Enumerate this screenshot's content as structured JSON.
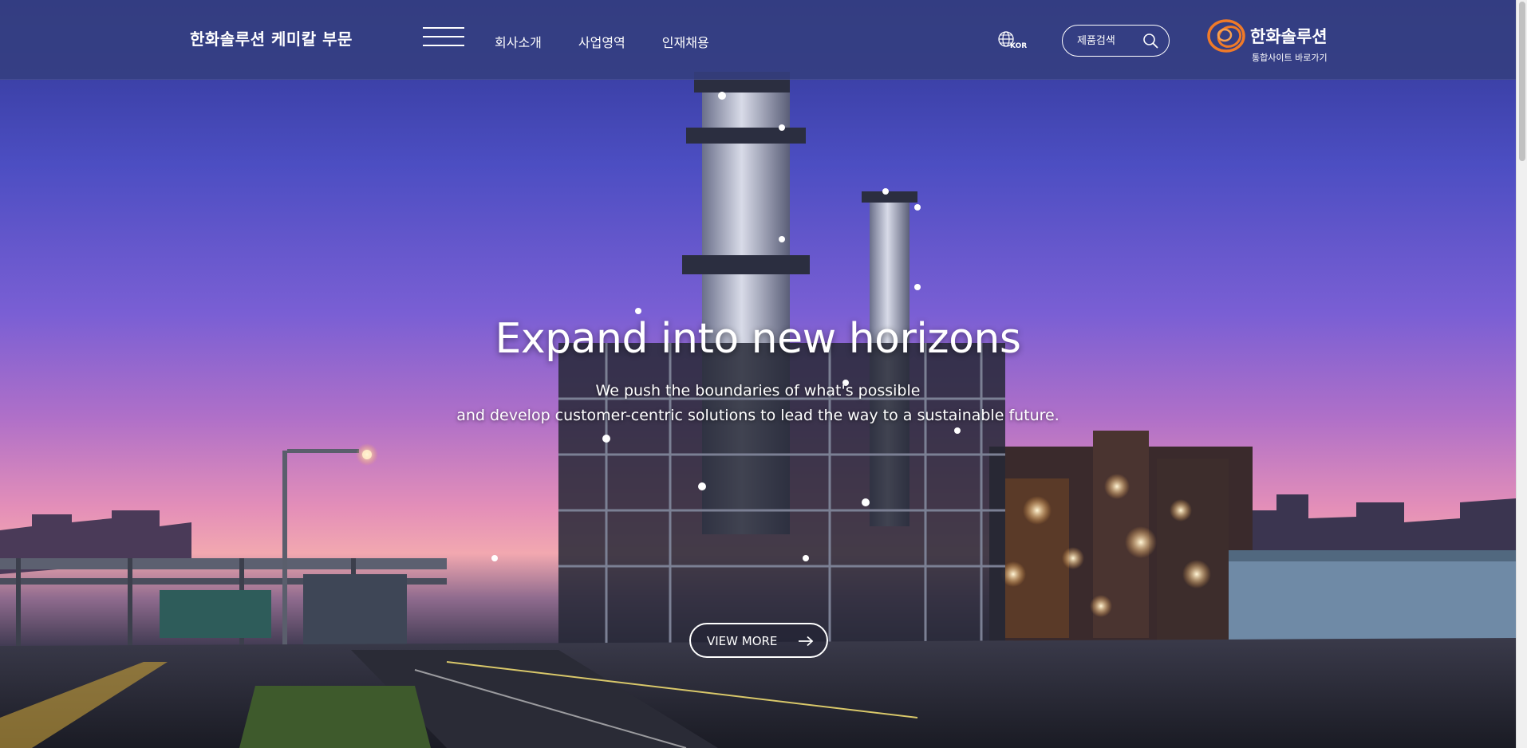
{
  "header": {
    "brand_title": "한화솔루션 케미칼 부문",
    "nav": [
      {
        "label": "회사소개"
      },
      {
        "label": "사업영역"
      },
      {
        "label": "인재채용"
      }
    ],
    "language": {
      "label": "KOR",
      "icon": "globe-icon"
    },
    "search": {
      "placeholder": "제품검색",
      "icon": "search-icon"
    },
    "corporate": {
      "name": "한화솔루션",
      "link_label": "통합사이트 바로가기",
      "logo_color": "#f07a28"
    }
  },
  "hero": {
    "title": "Expand into new horizons",
    "subtitle_line1": "We push the boundaries of what's possible",
    "subtitle_line2": "and develop customer-centric solutions to lead the way to a sustainable future.",
    "cta_label": "VIEW MORE",
    "cta_icon": "arrow-right-icon"
  },
  "colors": {
    "header_bg": "#343f80",
    "sky_top": "#2e3590",
    "sky_horizon": "#f2a8b0",
    "accent_orange": "#f07a28"
  }
}
